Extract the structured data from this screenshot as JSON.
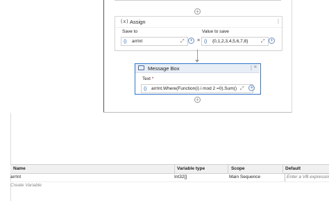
{
  "assign": {
    "icon_text": "(x)",
    "title": "Assign",
    "save_to_label": "Save to",
    "value_to_save_label": "Value to save",
    "save_to_value": "arrInt",
    "value_to_save_value": "{0,1,2,3,4,5,6,7,8}",
    "brace_glyph": "{}",
    "equals": "=",
    "menu_glyph": "⋮"
  },
  "message_box": {
    "title": "Message Box",
    "text_label": "Text",
    "required_mark": "*",
    "text_value": "arrInt.Where(Function(i) i mod 2 =0).Sum()",
    "brace_glyph": "{}",
    "menu_glyph": "⋮",
    "collapse_glyph": "≈"
  },
  "add_glyph": "+",
  "expand_glyph": "⤢",
  "variables": {
    "columns": [
      "Name",
      "Variable type",
      "Scope",
      "Default"
    ],
    "rows": [
      {
        "name": "arrInt",
        "type": "Int32[]",
        "scope": "Main Sequence",
        "default_placeholder": "Enter a VB expression"
      }
    ],
    "create_label": "Create Variable"
  }
}
